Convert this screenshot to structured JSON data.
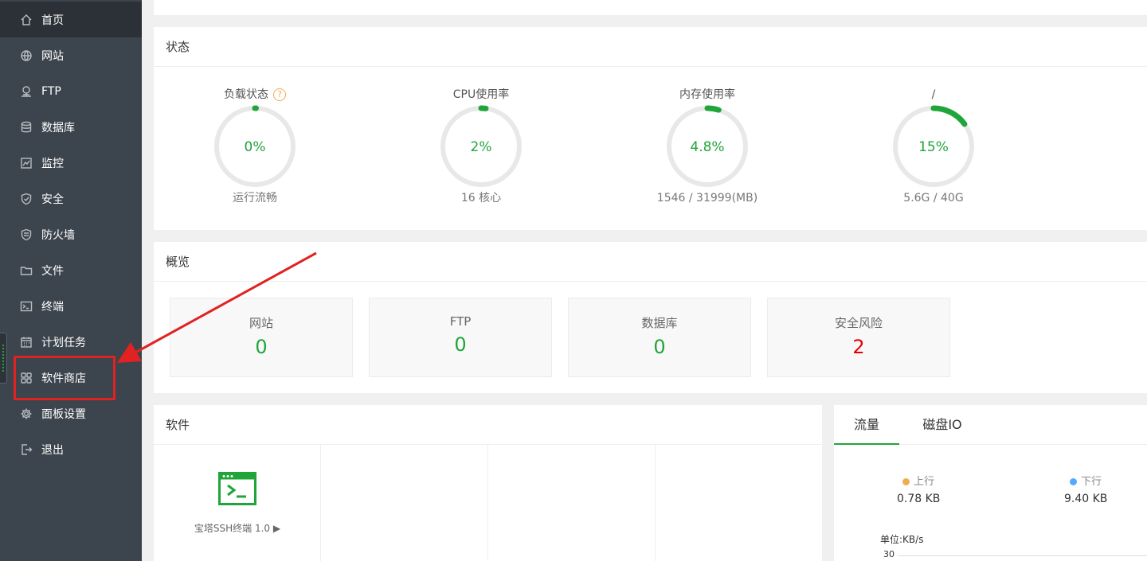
{
  "sidebar": {
    "items": [
      {
        "label": "首页",
        "icon": "home-icon",
        "active": true
      },
      {
        "label": "网站",
        "icon": "globe-icon"
      },
      {
        "label": "FTP",
        "icon": "ftp-icon"
      },
      {
        "label": "数据库",
        "icon": "database-icon"
      },
      {
        "label": "监控",
        "icon": "monitor-icon"
      },
      {
        "label": "安全",
        "icon": "shield-icon"
      },
      {
        "label": "防火墙",
        "icon": "firewall-icon"
      },
      {
        "label": "文件",
        "icon": "folder-icon"
      },
      {
        "label": "终端",
        "icon": "terminal-icon"
      },
      {
        "label": "计划任务",
        "icon": "calendar-icon"
      },
      {
        "label": "软件商店",
        "icon": "apps-grid-icon"
      },
      {
        "label": "面板设置",
        "icon": "gear-icon"
      },
      {
        "label": "退出",
        "icon": "logout-icon"
      }
    ]
  },
  "status": {
    "title": "状态",
    "gauges": [
      {
        "title": "负载状态",
        "value": "0%",
        "fraction": 0.0,
        "sub": "运行流畅",
        "help": "?"
      },
      {
        "title": "CPU使用率",
        "value": "2%",
        "fraction": 0.02,
        "sub": "16 核心"
      },
      {
        "title": "内存使用率",
        "value": "4.8%",
        "fraction": 0.048,
        "sub": "1546 / 31999(MB)"
      },
      {
        "title": "/",
        "value": "15%",
        "fraction": 0.15,
        "sub": "5.6G / 40G"
      }
    ]
  },
  "overview": {
    "title": "概览",
    "cards": [
      {
        "label": "网站",
        "value": "0"
      },
      {
        "label": "FTP",
        "value": "0"
      },
      {
        "label": "数据库",
        "value": "0"
      },
      {
        "label": "安全风险",
        "value": "2",
        "danger": true
      }
    ]
  },
  "software": {
    "title": "软件",
    "items": [
      {
        "name": "宝塔SSH终端 1.0 ▶",
        "icon": "terminal-window-icon"
      }
    ]
  },
  "traffic": {
    "tabs": [
      "流量",
      "磁盘IO"
    ],
    "up_label": "上行",
    "up_value": "0.78 KB",
    "down_label": "下行",
    "down_value": "9.40 KB",
    "unit": "单位:KB/s",
    "axis_top": "30"
  },
  "colors": {
    "accent": "#20a53a",
    "danger": "#e60000",
    "up_dot": "#f0ad4e",
    "down_dot": "#52a9ff",
    "annotation": "#e02222"
  }
}
